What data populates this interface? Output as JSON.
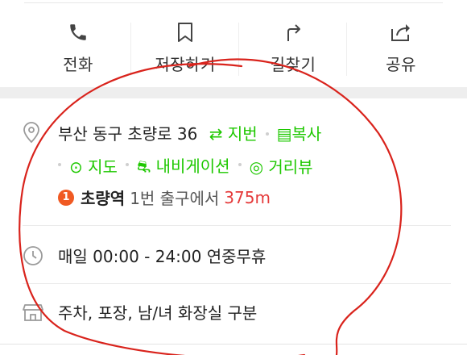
{
  "actions": [
    {
      "label": "전화",
      "icon": "phone-icon"
    },
    {
      "label": "저장하기",
      "icon": "bookmark-icon"
    },
    {
      "label": "길찾기",
      "icon": "directions-icon"
    },
    {
      "label": "공유",
      "icon": "share-icon"
    }
  ],
  "address": {
    "text": "부산 동구 초량로 36",
    "lot_link": "지번",
    "copy_link": "복사"
  },
  "map_links": {
    "map": "지도",
    "navigation": "내비게이션",
    "street_view": "거리뷰"
  },
  "subway": {
    "line_number": "1",
    "station": "초량역",
    "exit": "1번 출구에서",
    "distance": "375m"
  },
  "hours": "매일 00:00 - 24:00 연중무휴",
  "facilities": "주차, 포장, 남/녀 화장실 구분",
  "colors": {
    "accent_green": "#1ec800",
    "distance_red": "#e53b3b",
    "line_badge": "#f05a23",
    "annotation_circle": "#d9231c"
  }
}
